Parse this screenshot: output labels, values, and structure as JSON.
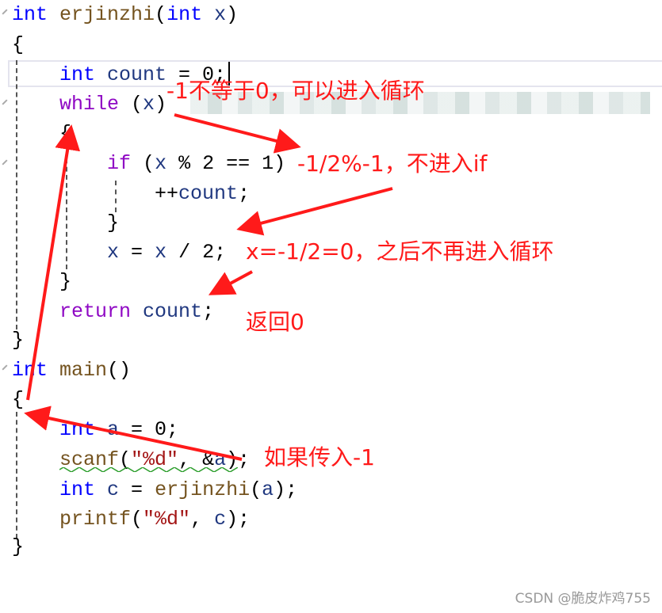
{
  "code_lines": [
    [
      [
        "kw",
        "int "
      ],
      [
        "fn",
        "erjinzhi"
      ],
      [
        "pl",
        "("
      ],
      [
        "kw",
        "int "
      ],
      [
        "id",
        "x"
      ],
      [
        "pl",
        ")"
      ]
    ],
    [
      [
        "pl",
        "{"
      ]
    ],
    [
      [
        "pl",
        "    "
      ],
      [
        "kw",
        "int "
      ],
      [
        "id",
        "count"
      ],
      [
        "pl",
        " = 0;"
      ]
    ],
    [
      [
        "pl",
        "    "
      ],
      [
        "ctl",
        "while"
      ],
      [
        "pl",
        " ("
      ],
      [
        "id",
        "x"
      ],
      [
        "pl",
        ")"
      ]
    ],
    [
      [
        "pl",
        "    {"
      ]
    ],
    [
      [
        "pl",
        "        "
      ],
      [
        "ctl",
        "if"
      ],
      [
        "pl",
        " ("
      ],
      [
        "id",
        "x"
      ],
      [
        "pl",
        " % 2 == 1)"
      ]
    ],
    [
      [
        "pl",
        "            ++"
      ],
      [
        "id",
        "count"
      ],
      [
        "pl",
        ";"
      ]
    ],
    [
      [
        "pl",
        "        }"
      ]
    ],
    [
      [
        "pl",
        "        "
      ],
      [
        "id",
        "x"
      ],
      [
        "pl",
        " = "
      ],
      [
        "id",
        "x"
      ],
      [
        "pl",
        " / 2;"
      ]
    ],
    [
      [
        "pl",
        "    }"
      ]
    ],
    [
      [
        "pl",
        "    "
      ],
      [
        "ctl",
        "return"
      ],
      [
        "pl",
        " "
      ],
      [
        "id",
        "count"
      ],
      [
        "pl",
        ";"
      ]
    ],
    [
      [
        "pl",
        "}"
      ]
    ],
    [
      [
        "kw",
        "int "
      ],
      [
        "fn",
        "main"
      ],
      [
        "pl",
        "()"
      ]
    ],
    [
      [
        "pl",
        "{"
      ]
    ],
    [
      [
        "pl",
        "    "
      ],
      [
        "kw",
        "int "
      ],
      [
        "id",
        "a"
      ],
      [
        "pl",
        " = 0;"
      ]
    ],
    [
      [
        "pl",
        "    "
      ],
      [
        "fn",
        "scanf"
      ],
      [
        "pl",
        "("
      ],
      [
        "str",
        "\"%d\""
      ],
      [
        "pl",
        ", &"
      ],
      [
        "id",
        "a"
      ],
      [
        "pl",
        ");"
      ]
    ],
    [
      [
        "pl",
        "    "
      ],
      [
        "kw",
        "int "
      ],
      [
        "id",
        "c"
      ],
      [
        "pl",
        " = "
      ],
      [
        "fn",
        "erjinzhi"
      ],
      [
        "pl",
        "("
      ],
      [
        "id",
        "a"
      ],
      [
        "pl",
        ");"
      ]
    ],
    [
      [
        "pl",
        "    "
      ],
      [
        "fn",
        "printf"
      ],
      [
        "pl",
        "("
      ],
      [
        "str",
        "\"%d\""
      ],
      [
        "pl",
        ", "
      ],
      [
        "id",
        "c"
      ],
      [
        "pl",
        ");"
      ]
    ],
    [
      [
        "pl",
        "}"
      ]
    ]
  ],
  "annotations": {
    "loop_enter": "-1不等于0，可以进入循环",
    "if_skip": "-1/2%-1，不进入if",
    "x_zero": "x=-1/2=0，之后不再进入循环",
    "return_zero": "返回0",
    "input": "如果传入-1"
  },
  "watermark": "CSDN @脆皮炸鸡755",
  "colors": {
    "annotation": "#ff1a1a",
    "keyword": "#0000ff",
    "function": "#74531f",
    "identifier": "#1f377f",
    "control": "#8f08c4"
  }
}
